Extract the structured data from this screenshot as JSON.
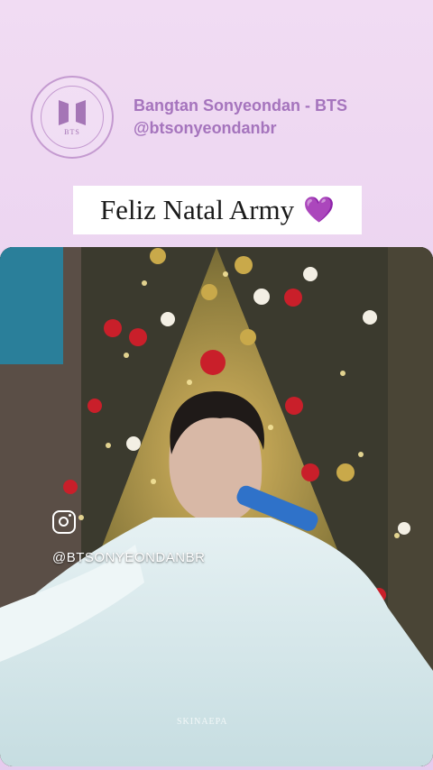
{
  "header": {
    "account_name": "Bangtan Sonyeondan - BTS",
    "account_handle": "@btsonyeondanbr",
    "logo_text": "BTS",
    "logo_icon": "bts-logo-icon"
  },
  "banner": {
    "text": "Feliz Natal Army",
    "emoji": "💜"
  },
  "video": {
    "overlay_icon": "instagram-icon",
    "overlay_handle": "@BTSONYEONDANBR",
    "watermark": "SKINAEPA"
  },
  "colors": {
    "background": "#ead2f0",
    "accent": "#a574bd",
    "heart": "#8e3fd6"
  }
}
